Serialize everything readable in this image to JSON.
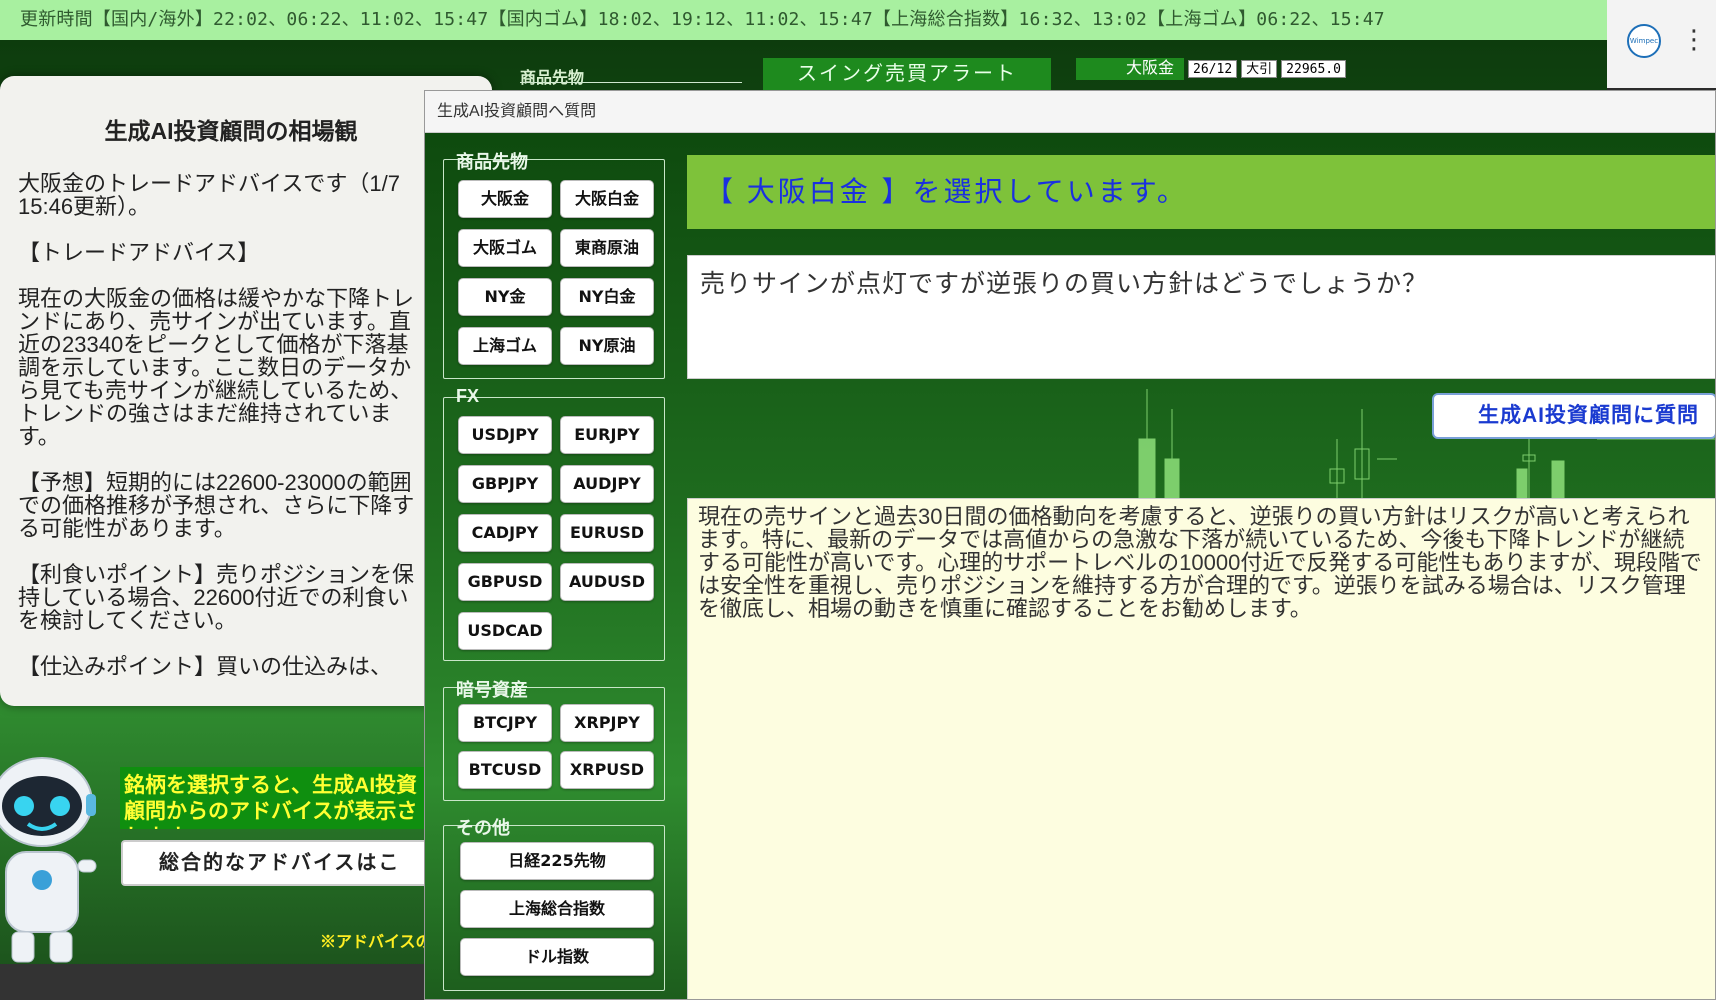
{
  "ticker": {
    "text": "更新時間【国内/海外】22:02、06:22、11:02、15:47【国内ゴム】18:02、19:12、11:02、15:47【上海総合指数】16:32、13:02【上海ゴム】06:22、15:47"
  },
  "browser": {
    "avatar_text": "Wimpec",
    "menu_glyph": "⋮"
  },
  "background": {
    "section_label": "商品先物",
    "swing_alert": "スイング売買アラート",
    "quote": {
      "name": "大阪金",
      "date": "26/12",
      "type": "大引",
      "price": "22965.0"
    }
  },
  "market_panel": {
    "title": "生成AI投資顧問の相場観",
    "body": "大阪金のトレードアドバイスです（1/7 15:46更新）。\n\n【トレードアドバイス】\n\n現在の大阪金の価格は緩やかな下降トレンドにあり、売サインが出ています。直近の23340をピークとして価格が下落基調を示しています。ここ数日のデータから見ても売サインが継続しているため、トレンドの強さはまだ維持されています。\n\n【予想】短期的には22600-23000の範囲での価格推移が予想され、さらに下降する可能性があります。\n\n【利食いポイント】売りポジションを保持している場合、22600付近での利食いを検討してください。\n\n【仕込みポイント】買いの仕込みは、"
  },
  "promo": {
    "text": "銘柄を選択すると、生成AI投資顧問からのアドバイスが表示されます。",
    "overall_button": "総合的なアドバイスはこ",
    "note": "※アドバイスの"
  },
  "dialog": {
    "title": "生成AI投資顧問へ質問",
    "groups": {
      "commodities": {
        "label": "商品先物",
        "buttons": [
          "大阪金",
          "大阪白金",
          "大阪ゴム",
          "東商原油",
          "NY金",
          "NY白金",
          "上海ゴム",
          "NY原油"
        ]
      },
      "fx": {
        "label": "FX",
        "buttons": [
          "USDJPY",
          "EURJPY",
          "GBPJPY",
          "AUDJPY",
          "CADJPY",
          "EURUSD",
          "GBPUSD",
          "AUDUSD",
          "USDCAD"
        ]
      },
      "crypto": {
        "label": "暗号資産",
        "buttons": [
          "BTCJPY",
          "XRPJPY",
          "BTCUSD",
          "XRPUSD"
        ]
      },
      "other": {
        "label": "その他",
        "buttons": [
          "日経225先物",
          "上海総合指数",
          "ドル指数"
        ]
      }
    },
    "selected_banner": "【 大阪白金 】を選択しています。",
    "question": "売りサインが点灯ですが逆張りの買い方針はどうでしょうか？",
    "ask_button": "生成AI投資顧問に質問",
    "answer": "現在の売サインと過去30日間の価格動向を考慮すると、逆張りの買い方針はリスクが高いと考えられます。特に、最新のデータでは高値からの急激な下落が続いているため、今後も下降トレンドが継続する可能性が高いです。心理的サポートレベルの10000付近で反発する可能性もありますが、現段階では安全性を重視し、売りポジションを維持する方が合理的です。逆張りを試みる場合は、リスク管理を徹底し、相場の動きを慎重に確認することをお勧めします。"
  }
}
